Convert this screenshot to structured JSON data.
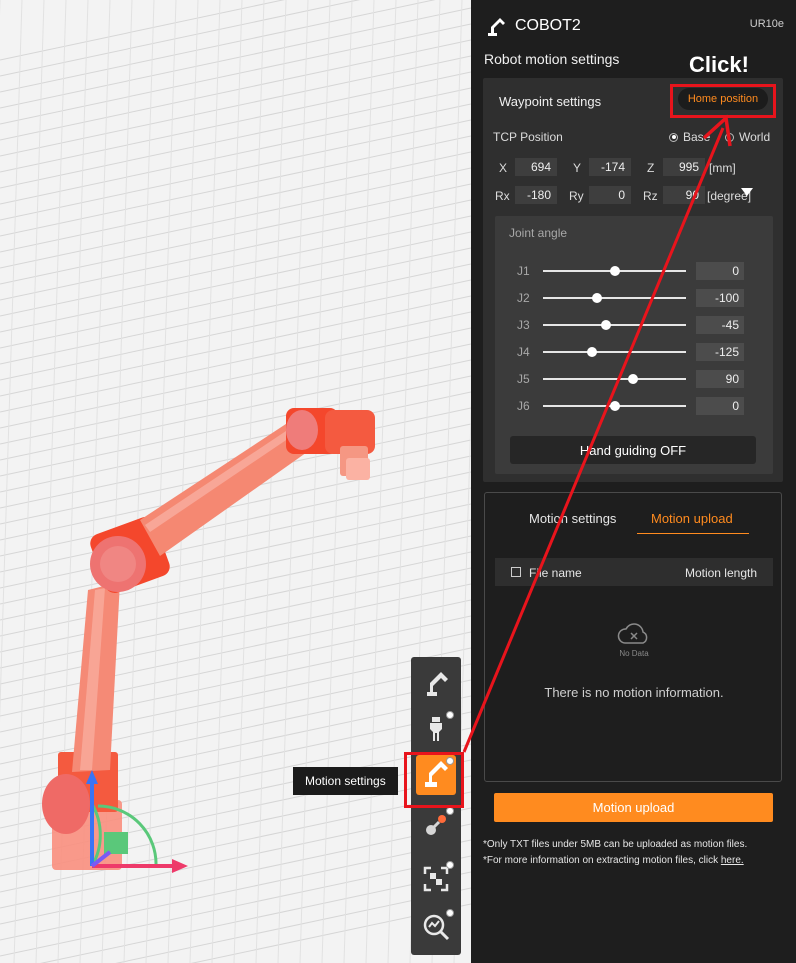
{
  "app": {
    "name": "COBOT2",
    "model": "UR10e",
    "logo_icon": "robot-arm-icon"
  },
  "panel": {
    "section_title": "Robot motion settings",
    "annotation": "Click!",
    "waypoint": {
      "title": "Waypoint settings",
      "home_button": "Home position",
      "tcp_label": "TCP Position",
      "radio_options": [
        {
          "label": "Base",
          "selected": true
        },
        {
          "label": "World",
          "selected": false
        }
      ],
      "coords": [
        {
          "label": "X",
          "value": "694"
        },
        {
          "label": "Y",
          "value": "-174"
        },
        {
          "label": "Z",
          "value": "995"
        },
        {
          "label": "Rx",
          "value": "-180"
        },
        {
          "label": "Ry",
          "value": "0"
        },
        {
          "label": "Rz",
          "value": "90"
        }
      ],
      "unit_pos": "[mm]",
      "unit_rot": "[degree]"
    },
    "joint": {
      "title": "Joint angle",
      "joints": [
        {
          "label": "J1",
          "value": "0",
          "slider": 0.5
        },
        {
          "label": "J2",
          "value": "-100",
          "slider": 0.38
        },
        {
          "label": "J3",
          "value": "-45",
          "slider": 0.44
        },
        {
          "label": "J4",
          "value": "-125",
          "slider": 0.34
        },
        {
          "label": "J5",
          "value": "90",
          "slider": 0.63
        },
        {
          "label": "J6",
          "value": "0",
          "slider": 0.5
        }
      ],
      "hand_guiding": "Hand guiding OFF"
    },
    "motion": {
      "tabs": [
        {
          "label": "Motion settings",
          "active": false
        },
        {
          "label": "Motion upload",
          "active": true
        }
      ],
      "col_file": "File name",
      "col_length": "Motion length",
      "no_data": "No Data",
      "empty_message": "There is no motion information."
    },
    "upload_button": "Motion upload",
    "note1": "*Only TXT files under 5MB can be uploaded as motion files.",
    "note2_prefix": "*For more information on extracting motion files, click ",
    "note2_link": "here."
  },
  "toolbar": {
    "tooltip": "Motion settings",
    "tools": [
      {
        "name": "robot-arm-icon",
        "active": false
      },
      {
        "name": "gripper-icon",
        "active": false
      },
      {
        "name": "motion-settings-icon",
        "active": true
      },
      {
        "name": "joint-icon",
        "active": false
      },
      {
        "name": "fit-view-icon",
        "active": false
      },
      {
        "name": "analysis-icon",
        "active": false
      }
    ]
  },
  "colors": {
    "accent": "#ff8b1f",
    "highlight": "#e8141c",
    "robot": "#f5452a"
  }
}
